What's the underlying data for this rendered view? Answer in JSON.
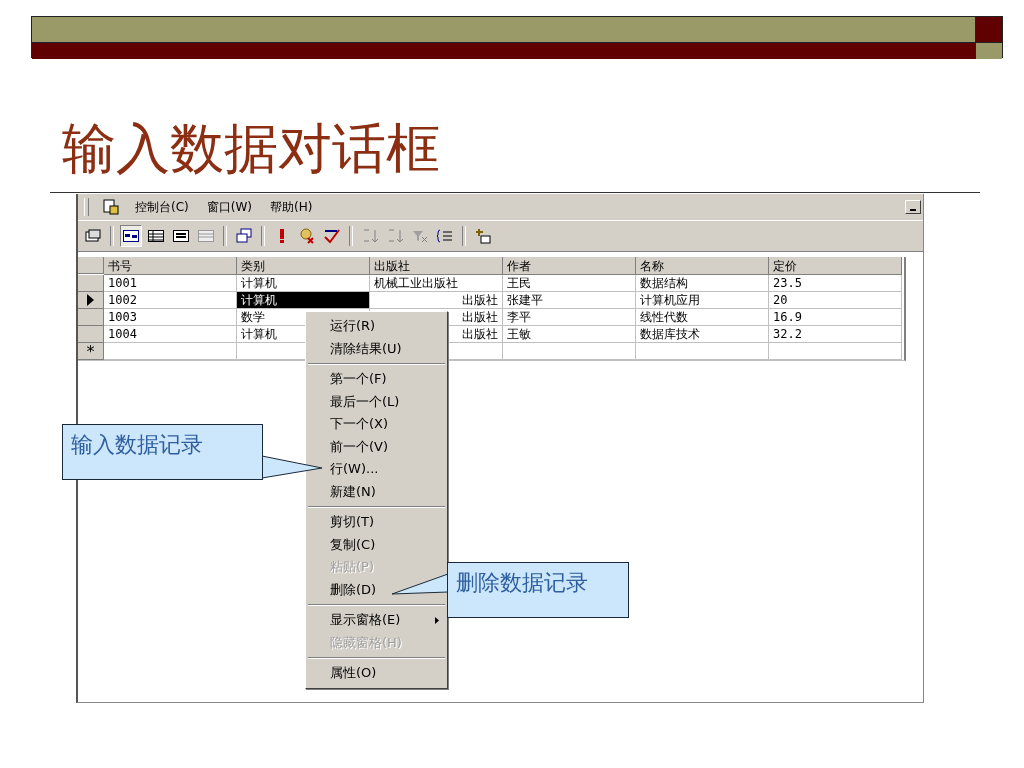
{
  "slide": {
    "title": "输入数据对话框"
  },
  "window": {
    "menu": [
      {
        "label": "控制台(C)"
      },
      {
        "label": "窗口(W)"
      },
      {
        "label": "帮助(H)"
      }
    ],
    "toolbar": [
      {
        "buttons": [
          {
            "kind": "properties",
            "pressed": false
          }
        ]
      },
      {
        "buttons": [
          {
            "kind": "diagram",
            "pressed": true
          },
          {
            "kind": "grid",
            "pressed": false
          },
          {
            "kind": "sql",
            "pressed": false
          },
          {
            "kind": "results",
            "pressed": false
          }
        ]
      },
      {
        "buttons": [
          {
            "kind": "windows",
            "pressed": false
          }
        ]
      },
      {
        "buttons": [
          {
            "kind": "run",
            "pressed": false
          },
          {
            "kind": "verify",
            "pressed": false
          },
          {
            "kind": "check",
            "pressed": false
          }
        ]
      },
      {
        "buttons": [
          {
            "kind": "sortasc",
            "pressed": false
          },
          {
            "kind": "sortdesc",
            "pressed": false
          },
          {
            "kind": "filter",
            "pressed": false
          },
          {
            "kind": "group",
            "pressed": false
          }
        ]
      },
      {
        "buttons": [
          {
            "kind": "addtable",
            "pressed": false
          }
        ]
      }
    ],
    "table": {
      "columns": [
        "书号",
        "类别",
        "出版社",
        "作者",
        "名称",
        "定价"
      ],
      "rows": [
        {
          "current": false,
          "cells": [
            {
              "text": "1001",
              "selected": false,
              "clipped": false
            },
            {
              "text": "计算机",
              "selected": false,
              "clipped": false
            },
            {
              "text": "机械工业出版社",
              "selected": false,
              "clipped": false
            },
            {
              "text": "王民",
              "selected": false,
              "clipped": false
            },
            {
              "text": "数据结构",
              "selected": false,
              "clipped": false
            },
            {
              "text": "23.5",
              "selected": false,
              "clipped": false
            }
          ]
        },
        {
          "current": true,
          "cells": [
            {
              "text": "1002",
              "selected": false,
              "clipped": false
            },
            {
              "text": "计算机",
              "selected": true,
              "clipped": false
            },
            {
              "text": "出版社",
              "selected": false,
              "clipped": true
            },
            {
              "text": "张建平",
              "selected": false,
              "clipped": false
            },
            {
              "text": "计算机应用",
              "selected": false,
              "clipped": false
            },
            {
              "text": "20",
              "selected": false,
              "clipped": false
            }
          ]
        },
        {
          "current": false,
          "cells": [
            {
              "text": "1003",
              "selected": false,
              "clipped": false
            },
            {
              "text": "数学",
              "selected": false,
              "clipped": false
            },
            {
              "text": "出版社",
              "selected": false,
              "clipped": true
            },
            {
              "text": "李平",
              "selected": false,
              "clipped": false
            },
            {
              "text": "线性代数",
              "selected": false,
              "clipped": false
            },
            {
              "text": "16.9",
              "selected": false,
              "clipped": false
            }
          ]
        },
        {
          "current": false,
          "cells": [
            {
              "text": "1004",
              "selected": false,
              "clipped": false
            },
            {
              "text": "计算机",
              "selected": false,
              "clipped": false
            },
            {
              "text": "出版社",
              "selected": false,
              "clipped": true
            },
            {
              "text": "王敏",
              "selected": false,
              "clipped": false
            },
            {
              "text": "数据库技术",
              "selected": false,
              "clipped": false
            },
            {
              "text": "32.2",
              "selected": false,
              "clipped": false
            }
          ]
        }
      ],
      "new_row": {
        "marker": "*"
      }
    },
    "context_menu": [
      {
        "kind": "item",
        "label": "运行(R)",
        "disabled": false
      },
      {
        "kind": "item",
        "label": "清除结果(U)",
        "disabled": false
      },
      {
        "kind": "separator"
      },
      {
        "kind": "item",
        "label": "第一个(F)",
        "disabled": false
      },
      {
        "kind": "item",
        "label": "最后一个(L)",
        "disabled": false
      },
      {
        "kind": "item",
        "label": "下一个(X)",
        "disabled": false
      },
      {
        "kind": "item",
        "label": "前一个(V)",
        "disabled": false
      },
      {
        "kind": "item",
        "label": "行(W)...",
        "disabled": false
      },
      {
        "kind": "item",
        "label": "新建(N)",
        "disabled": false
      },
      {
        "kind": "separator"
      },
      {
        "kind": "item",
        "label": "剪切(T)",
        "disabled": false
      },
      {
        "kind": "item",
        "label": "复制(C)",
        "disabled": false
      },
      {
        "kind": "item",
        "label": "粘贴(P)",
        "disabled": true
      },
      {
        "kind": "item",
        "label": "删除(D)",
        "disabled": false
      },
      {
        "kind": "separator"
      },
      {
        "kind": "submenu",
        "label": "显示窗格(E)",
        "disabled": false
      },
      {
        "kind": "item",
        "label": "隐藏窗格(H)",
        "disabled": true
      },
      {
        "kind": "separator"
      },
      {
        "kind": "item",
        "label": "属性(O)",
        "disabled": false
      }
    ]
  },
  "callouts": [
    {
      "text": "输入数据记录"
    },
    {
      "text": "删除数据记录"
    }
  ]
}
